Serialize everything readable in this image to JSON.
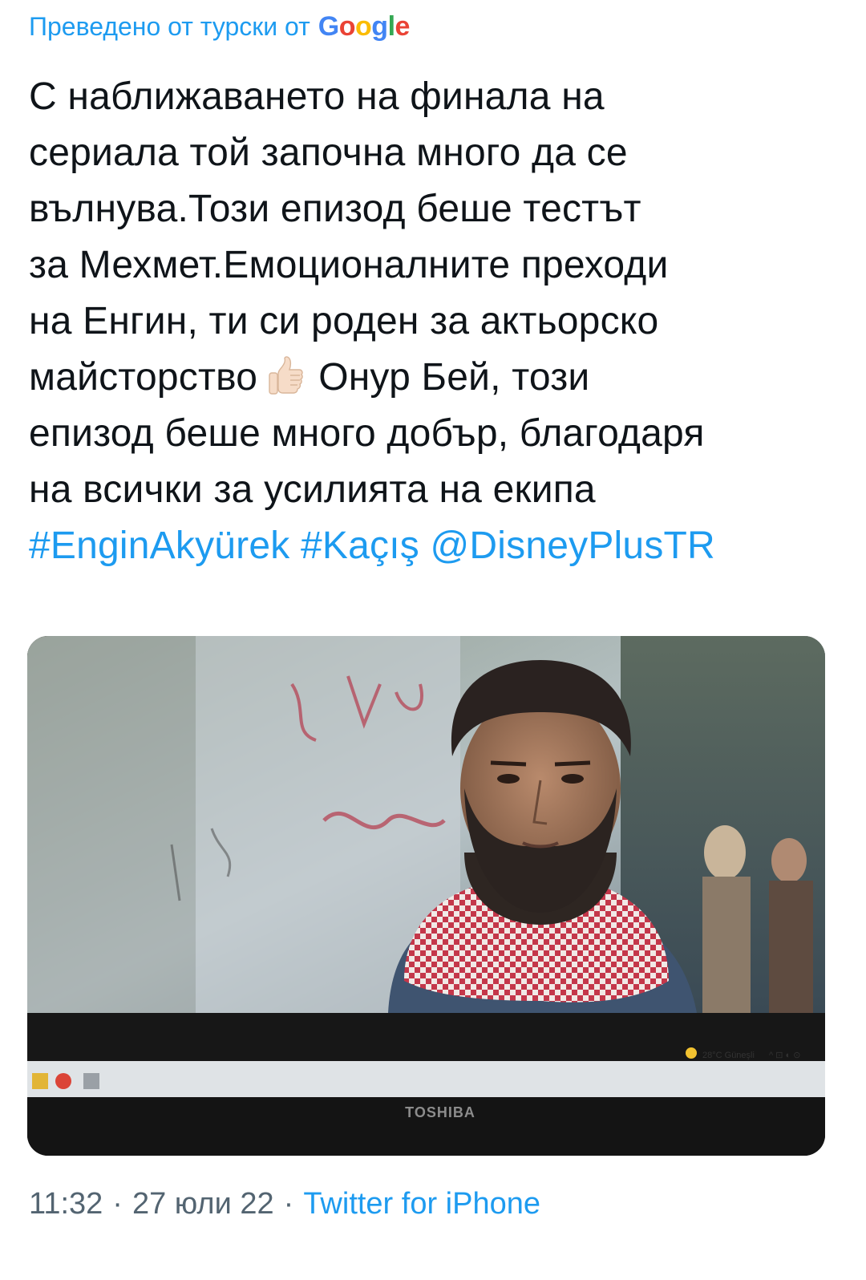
{
  "translation": {
    "prefix": "Преведено от турски от",
    "provider_letters": [
      "G",
      "o",
      "o",
      "g",
      "l",
      "e"
    ]
  },
  "tweet": {
    "lines": [
      "С наближаването на финала на",
      "сериала той започна много да се",
      "вълнува.Този епизод беше тестът",
      "за Мехмет.Емоционалните преходи",
      "на Енгин, ти си роден за актьорско"
    ],
    "line6_before_emoji": "майсторство",
    "emoji_name": "thumbs-up-emoji",
    "line6_after_emoji": "Онур Бей, този",
    "lines_after": [
      "епизод беше много добър, благодаря",
      "на всички за усилията на екипа"
    ],
    "hashtags": [
      "#EnginAkyürek",
      "#Kaçış"
    ],
    "mention": "@DisneyPlusTR"
  },
  "media": {
    "laptop_brand": "TOSHIBA",
    "taskbar_weather": "28°C  Güneşli"
  },
  "meta": {
    "time": "11:32",
    "date": "27 юли 22",
    "source": "Twitter for iPhone"
  },
  "colors": {
    "link": "#1d9bf0",
    "text": "#0f1419",
    "meta": "#536471"
  }
}
